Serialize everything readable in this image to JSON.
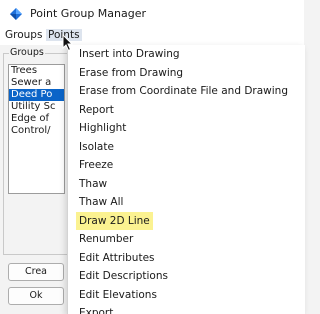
{
  "window": {
    "title": "Point Group Manager"
  },
  "menubar": {
    "items": [
      {
        "label": "Groups"
      },
      {
        "label": "Points"
      }
    ]
  },
  "groups_panel": {
    "label": "Groups",
    "items": [
      "Trees",
      "Sewer a",
      "Deed Po",
      "Utility Sc",
      "Edge of",
      "Control/"
    ],
    "selected": "Deed Po"
  },
  "buttons": {
    "create": "Crea",
    "ok": "Ok"
  },
  "points_menu": {
    "items": [
      "Insert into Drawing",
      "Erase from Drawing",
      "Erase from Coordinate File and Drawing",
      "Report",
      "Highlight",
      "Isolate",
      "Freeze",
      "Thaw",
      "Thaw All",
      "Draw 2D Line",
      "Renumber",
      "Edit Attributes",
      "Edit Descriptions",
      "Edit Elevations",
      "Export"
    ],
    "highlighted": "Draw 2D Line",
    "highlight_color": "#fbf291"
  },
  "icons": {
    "app": "diamond-app-icon",
    "cursor": "mouse-pointer-icon"
  },
  "colors": {
    "selection": "#0a64c8",
    "menu_hover": "#dde4ee"
  }
}
